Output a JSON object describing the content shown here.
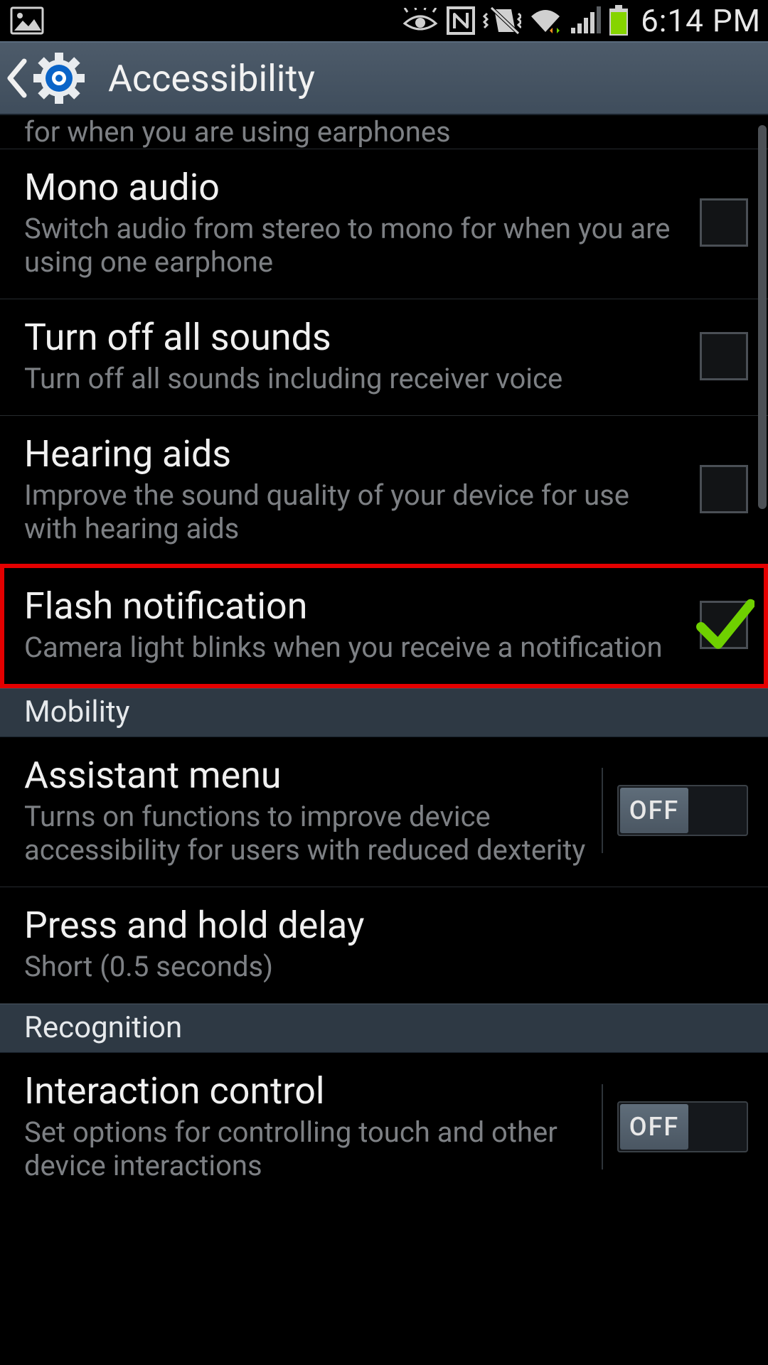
{
  "status": {
    "clock": "6:14 PM"
  },
  "header": {
    "title": "Accessibility"
  },
  "cutoff_text": "for when you are using earphones",
  "rows": {
    "mono_audio": {
      "title": "Mono audio",
      "sub": "Switch audio from stereo to mono for when you are using one earphone"
    },
    "turn_off_sounds": {
      "title": "Turn off all sounds",
      "sub": "Turn off all sounds including receiver voice"
    },
    "hearing_aids": {
      "title": "Hearing aids",
      "sub": "Improve the sound quality of your device for use with hearing aids"
    },
    "flash_notification": {
      "title": "Flash notification",
      "sub": "Camera light blinks when you receive a notification"
    },
    "assistant_menu": {
      "title": "Assistant menu",
      "sub": "Turns on functions to improve device accessibility for users with reduced dexterity",
      "toggle": "OFF"
    },
    "press_hold": {
      "title": "Press and hold delay",
      "sub": "Short (0.5 seconds)"
    },
    "interaction_control": {
      "title": "Interaction control",
      "sub": "Set options for controlling touch and other device interactions",
      "toggle": "OFF"
    }
  },
  "sections": {
    "mobility": "Mobility",
    "recognition": "Recognition"
  }
}
